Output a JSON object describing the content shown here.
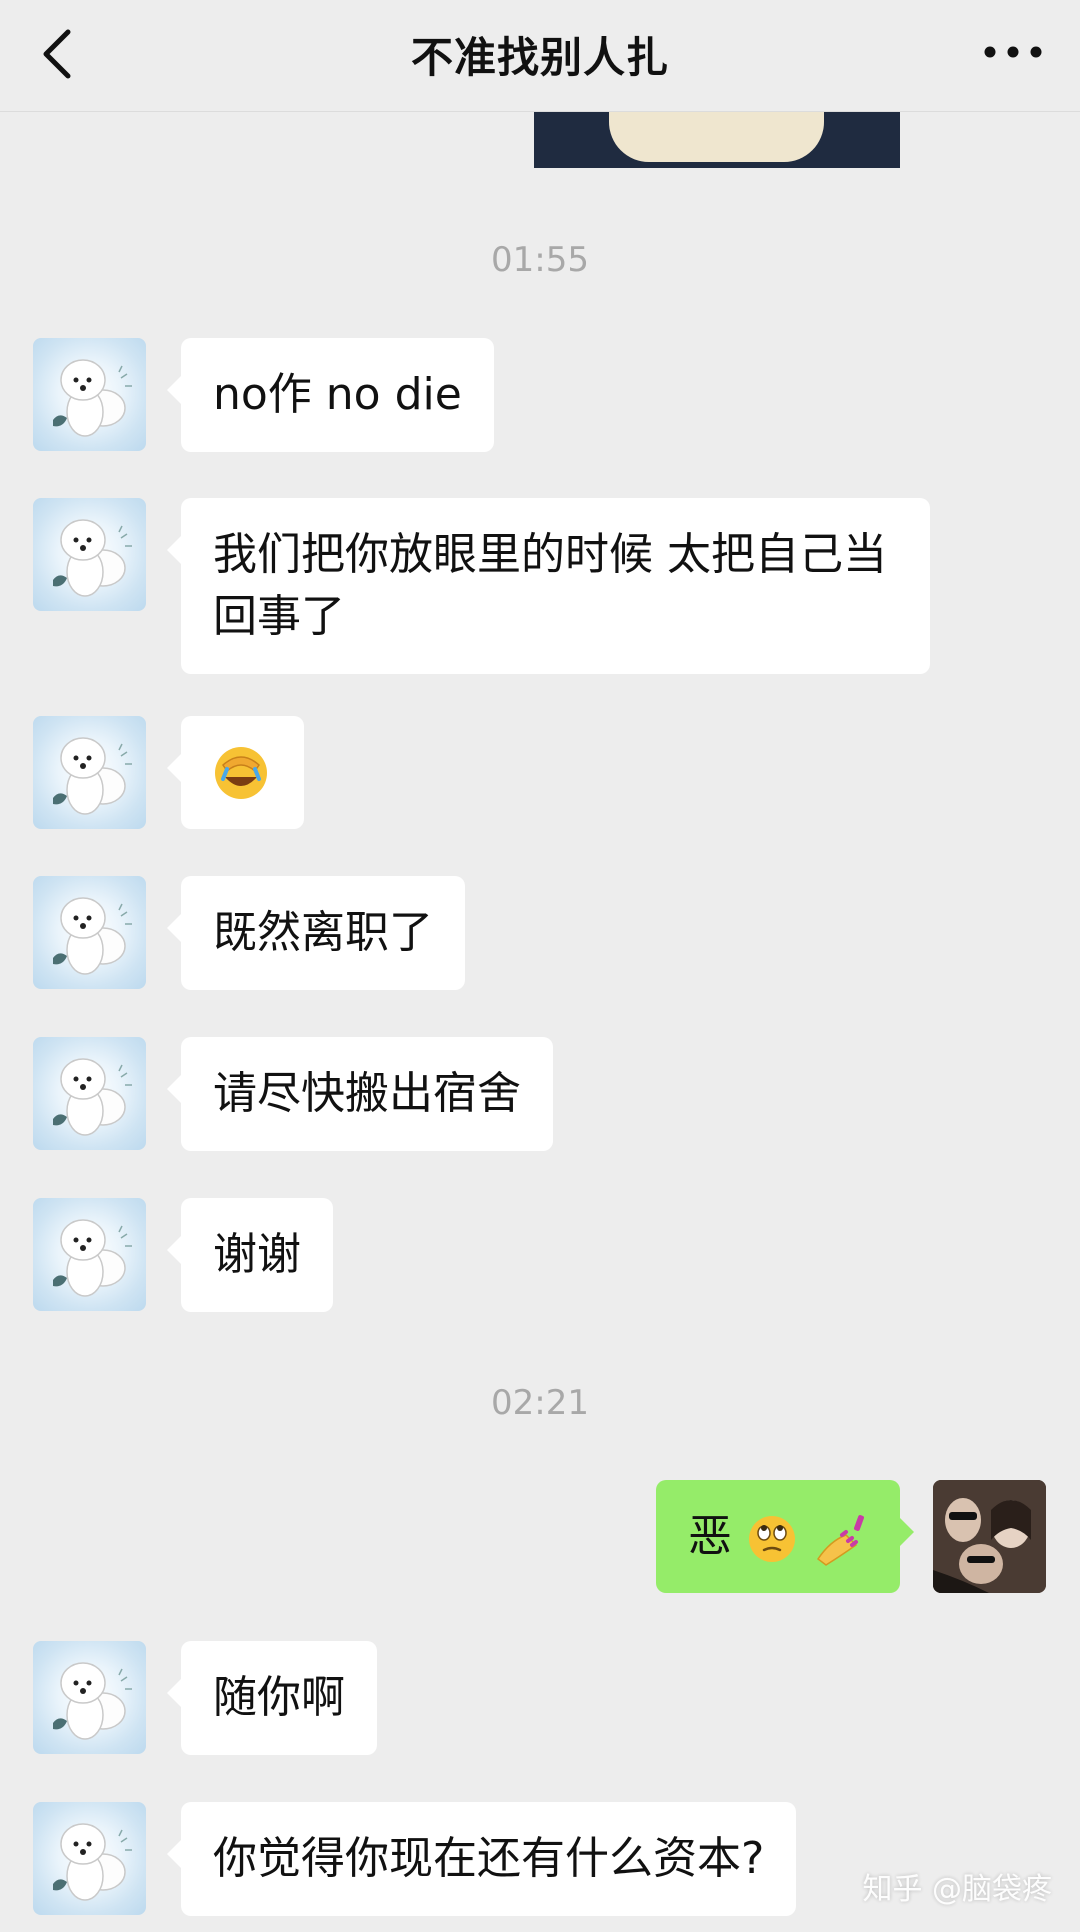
{
  "header": {
    "title": "不准找别人扎",
    "back_icon": "chevron-left-icon",
    "more_icon": "more-dots-icon"
  },
  "timestamps": [
    "01:55",
    "02:21"
  ],
  "messages": [
    {
      "sender": "other",
      "text": "no作 no die"
    },
    {
      "sender": "other",
      "text": "我们把你放眼里的时候 太把自己当回事了"
    },
    {
      "sender": "other",
      "emoji": "facepalm-laughing-emoji"
    },
    {
      "sender": "other",
      "text": "既然离职了"
    },
    {
      "sender": "other",
      "text": "请尽快搬出宿舍"
    },
    {
      "sender": "other",
      "text": "谢谢"
    },
    {
      "sender": "me",
      "text": "恶",
      "emojis": [
        "eye-roll-emoji",
        "nail-polish-emoji"
      ]
    },
    {
      "sender": "other",
      "text": "随你啊"
    },
    {
      "sender": "other",
      "text": "你觉得你现在还有什么资本?"
    }
  ],
  "watermark": "知乎 @脑袋疼",
  "colors": {
    "background": "#ededed",
    "bubble_other": "#ffffff",
    "bubble_me": "#95ec69",
    "timestamp": "#a8a8a8"
  }
}
